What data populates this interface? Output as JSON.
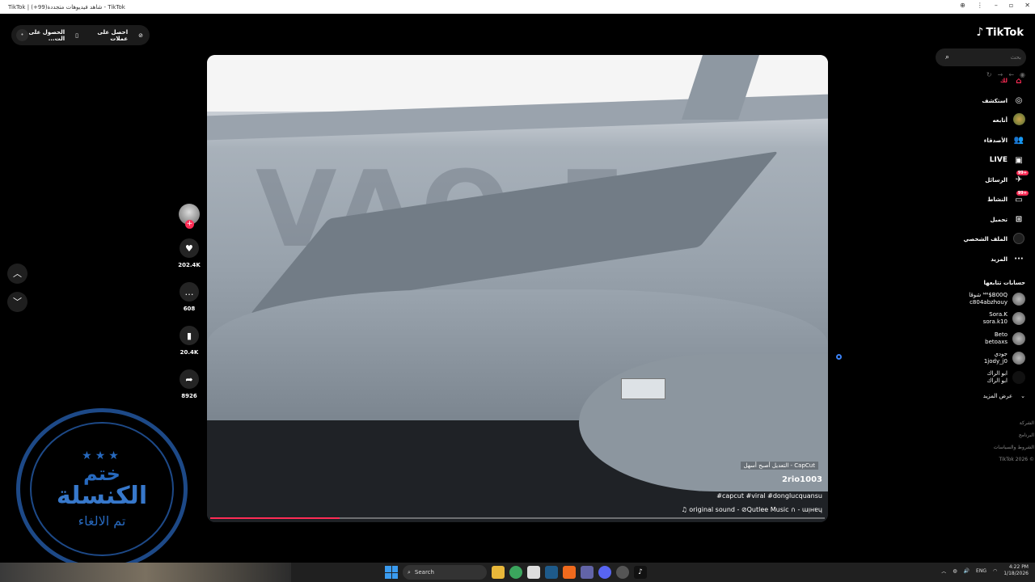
{
  "browser": {
    "title": "TikTok | شاهد فيديوهات متجددة(99+) - TikTok"
  },
  "promo": {
    "get_coins": "احصل على عملات",
    "get_app": "الحصول على الت..."
  },
  "video": {
    "capcut_label": "CapCut - التعديل أصبح أسهل",
    "author": "2rio1003",
    "hashtags": "#capcut #viral #donglucquansu",
    "sound": "original sound - ⊘Qutlee Music ∩ - ɯᴉʜɐɥ",
    "overlay_text": "VAO 56",
    "progress": 0.21
  },
  "actions": {
    "likes": "202.4K",
    "comments": "608",
    "saves": "20.4K",
    "shares": "8926"
  },
  "sidebar": {
    "logo": "TikTok",
    "search_placeholder": "بحث",
    "items": [
      {
        "label": "لك",
        "icon": "home-icon"
      },
      {
        "label": "استكشف",
        "icon": "compass-icon"
      },
      {
        "label": "أتابعه",
        "icon": "following-avatar-icon"
      },
      {
        "label": "الأصدقاء",
        "icon": "friends-icon"
      },
      {
        "label": "LIVE",
        "icon": "live-icon"
      },
      {
        "label": "الرسائل",
        "icon": "messages-icon",
        "badge": "+99"
      },
      {
        "label": "النشاط",
        "icon": "activity-icon",
        "badge": "+99"
      },
      {
        "label": "تحميل",
        "icon": "upload-icon"
      },
      {
        "label": "الملف الشخصي",
        "icon": "profile-icon"
      },
      {
        "label": "المزيد",
        "icon": "more-icon"
      }
    ],
    "following_title": "حسابات تتابعها",
    "following": [
      {
        "name": "ᴹᴿ$B00Q شوقا",
        "handle": "c804abzhouy"
      },
      {
        "name": "Sora.K",
        "handle": "sora.k10"
      },
      {
        "name": "Beto",
        "handle": "betoaxs"
      },
      {
        "name": "جودي",
        "handle": "1jody_j0"
      },
      {
        "name": "ابو الراك",
        "handle": "ابو الراك"
      }
    ],
    "see_more": "عرض المزيد",
    "footer": [
      "الشركة",
      "البرنامج",
      "الشروط والسياسات",
      "© TikTok 2026"
    ]
  },
  "stamp": {
    "line1": "ختم",
    "line2": "الكنسلة",
    "line3": "تم الالغاء"
  },
  "taskbar": {
    "search": "Search",
    "lang": "ENG",
    "time": "4:22 PM",
    "date": "1/18/2026"
  }
}
